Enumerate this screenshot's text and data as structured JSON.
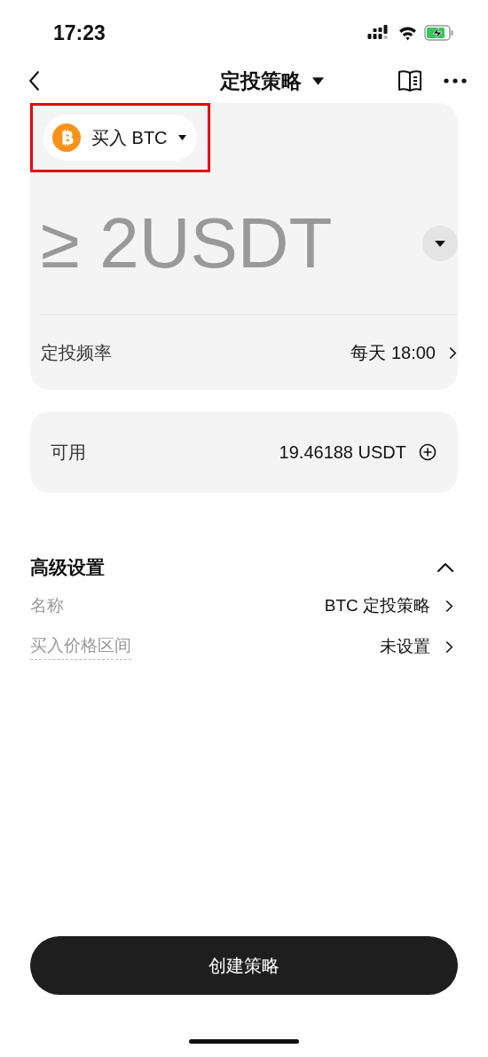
{
  "status_bar": {
    "time": "17:23"
  },
  "nav": {
    "title": "定投策略"
  },
  "order_card": {
    "coin_selector": {
      "label": "买入 BTC",
      "highlighted": true
    },
    "amount": {
      "placeholder": "≥ 2USDT"
    },
    "frequency": {
      "label": "定投频率",
      "value": "每天 18:00"
    }
  },
  "balance_card": {
    "label": "可用",
    "value": "19.46188 USDT"
  },
  "advanced": {
    "title": "高级设置",
    "expanded": true,
    "rows": [
      {
        "label": "名称",
        "value": "BTC 定投策略",
        "kind": "plain"
      },
      {
        "label": "买入价格区间",
        "value": "未设置",
        "kind": "hint"
      }
    ]
  },
  "submit_button": {
    "label": "创建策略"
  }
}
